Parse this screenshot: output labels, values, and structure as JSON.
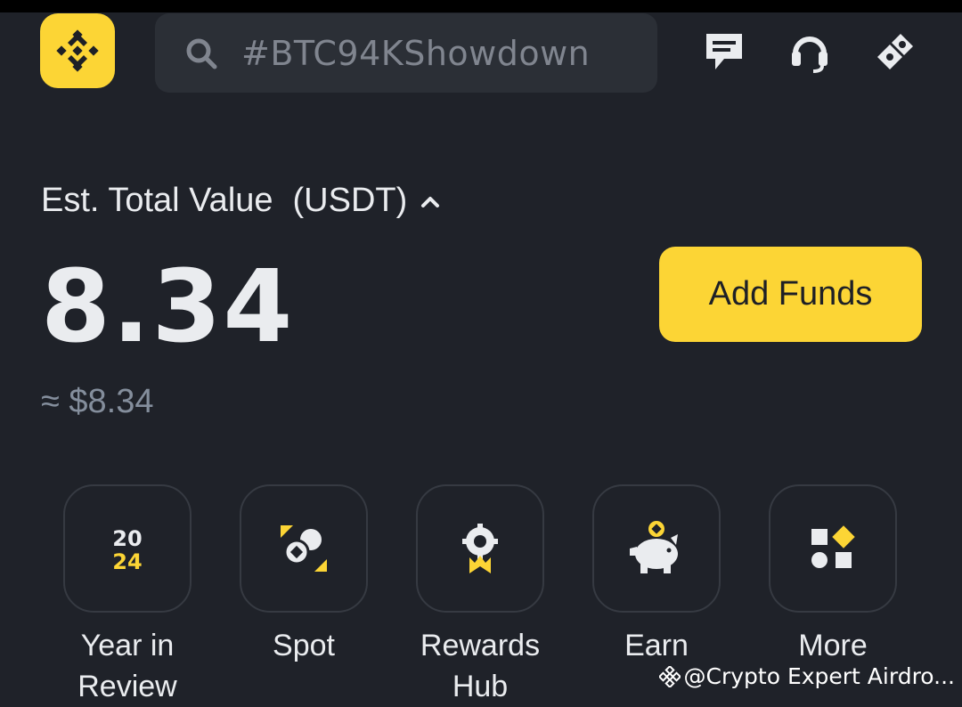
{
  "header": {
    "search_text": "#BTC94KShowdown",
    "icons": [
      "binance-logo-icon",
      "search-icon",
      "chat-icon",
      "support-headset-icon",
      "referral-icon"
    ]
  },
  "balance": {
    "title": "Est. Total Value",
    "unit": "(USDT)",
    "value": "8.34",
    "fiat_approx": "≈ $8.34"
  },
  "actions": {
    "add_funds_label": "Add Funds"
  },
  "shortcuts": [
    {
      "label_line1": "Year in",
      "label_line2": "Review",
      "icon": "year-2024-icon"
    },
    {
      "label_line1": "Spot",
      "label_line2": "",
      "icon": "spot-icon"
    },
    {
      "label_line1": "Rewards",
      "label_line2": "Hub",
      "icon": "rewards-badge-icon"
    },
    {
      "label_line1": "Earn",
      "label_line2": "",
      "icon": "piggy-bank-icon"
    },
    {
      "label_line1": "More",
      "label_line2": "",
      "icon": "more-grid-icon"
    }
  ],
  "watermark": "@Crypto Expert Airdro...",
  "colors": {
    "background": "#1f2229",
    "accent": "#fcd535",
    "surface": "#2b2f36",
    "muted_text": "#848e9c"
  }
}
